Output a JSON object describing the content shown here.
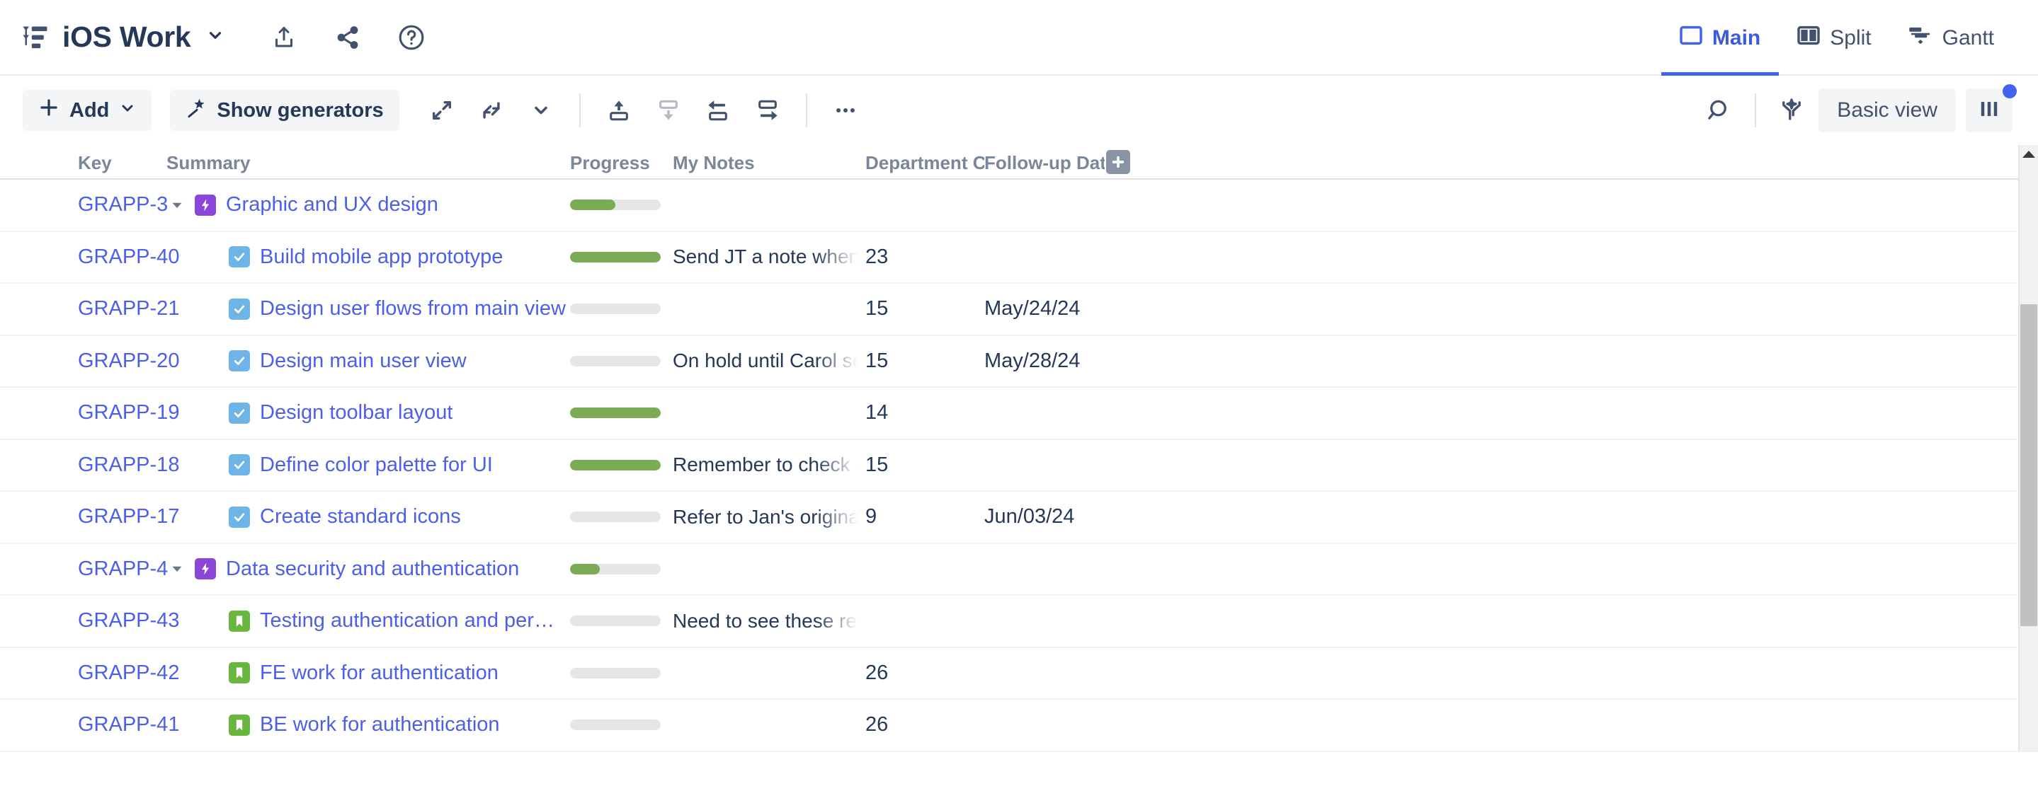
{
  "header": {
    "project_icon": "structure-icon",
    "title": "iOS Work",
    "title_chevron": "chevron-down-icon",
    "actions": [
      {
        "name": "export-icon",
        "label": "Export"
      },
      {
        "name": "share-icon",
        "label": "Share"
      },
      {
        "name": "help-icon",
        "label": "Help"
      }
    ],
    "view_tabs": [
      {
        "label": "Main",
        "icon": "panel-icon",
        "active": true
      },
      {
        "label": "Split",
        "icon": "split-panel-icon",
        "active": false
      },
      {
        "label": "Gantt",
        "icon": "gantt-icon",
        "active": false
      }
    ]
  },
  "toolbar": {
    "add_label": "Add",
    "add_icon": "plus-icon",
    "add_chevron": "chevron-down-icon",
    "generators_label": "Show generators",
    "generators_icon": "magic-wand-icon",
    "expand_all_icon": "expand-arrows-icon",
    "collapse_all_icon": "collapse-arrows-icon",
    "level_chevron_icon": "chevron-down-icon",
    "move_up_icon": "move-up-icon",
    "move_down_icon": "move-down-icon",
    "outdent_icon": "outdent-icon",
    "indent_icon": "indent-icon",
    "more_icon": "more-horizontal-icon",
    "search_icon": "search-icon",
    "filter_icon": "magic-filter-icon",
    "view_label": "Basic view",
    "columns_icon": "columns-icon"
  },
  "table": {
    "columns": [
      "Key",
      "Summary",
      "Progress",
      "My Notes",
      "Department Code",
      "Follow-up Date"
    ],
    "add_column_icon": "plus-icon",
    "rows": [
      {
        "key": "GRAPP-3",
        "summary": "Graphic and UX design",
        "type": "epic",
        "indent": 0,
        "expanded": true,
        "has_children": true,
        "progress": 50,
        "notes": "",
        "dept": "",
        "date": ""
      },
      {
        "key": "GRAPP-40",
        "summary": "Build mobile app prototype",
        "type": "task",
        "indent": 1,
        "expanded": false,
        "has_children": false,
        "progress": 100,
        "notes": "Send JT a note when finished.",
        "dept": "23",
        "date": ""
      },
      {
        "key": "GRAPP-21",
        "summary": "Design user flows from main view",
        "type": "task",
        "indent": 1,
        "expanded": false,
        "has_children": false,
        "progress": 0,
        "notes": "",
        "dept": "15",
        "date": "May/24/24"
      },
      {
        "key": "GRAPP-20",
        "summary": "Design main user view",
        "type": "task",
        "indent": 1,
        "expanded": false,
        "has_children": false,
        "progress": 0,
        "notes": "On hold until Carol sends feedback",
        "dept": "15",
        "date": "May/28/24"
      },
      {
        "key": "GRAPP-19",
        "summary": "Design toolbar layout",
        "type": "task",
        "indent": 1,
        "expanded": false,
        "has_children": false,
        "progress": 100,
        "notes": "",
        "dept": "14",
        "date": ""
      },
      {
        "key": "GRAPP-18",
        "summary": "Define color palette for UI",
        "type": "task",
        "indent": 1,
        "expanded": false,
        "has_children": false,
        "progress": 100,
        "notes": "Remember to check contrast.",
        "dept": "15",
        "date": ""
      },
      {
        "key": "GRAPP-17",
        "summary": "Create standard icons",
        "type": "task",
        "indent": 1,
        "expanded": false,
        "has_children": false,
        "progress": 0,
        "notes": "Refer to Jan's original designs.",
        "dept": "9",
        "date": "Jun/03/24"
      },
      {
        "key": "GRAPP-4",
        "summary": "Data security and authentication",
        "type": "epic",
        "indent": 0,
        "expanded": true,
        "has_children": true,
        "progress": 33,
        "notes": "",
        "dept": "",
        "date": ""
      },
      {
        "key": "GRAPP-43",
        "summary": "Testing authentication and permissions",
        "type": "story",
        "indent": 1,
        "expanded": false,
        "has_children": false,
        "progress": 0,
        "notes": "Need to see these results before finishing",
        "dept": "",
        "date": ""
      },
      {
        "key": "GRAPP-42",
        "summary": "FE work for authentication",
        "type": "story",
        "indent": 1,
        "expanded": false,
        "has_children": false,
        "progress": 0,
        "notes": "",
        "dept": "26",
        "date": ""
      },
      {
        "key": "GRAPP-41",
        "summary": "BE work for authentication",
        "type": "story",
        "indent": 1,
        "expanded": false,
        "has_children": false,
        "progress": 0,
        "notes": "",
        "dept": "26",
        "date": ""
      }
    ]
  },
  "scrollbar": {
    "up_arrow_icon": "caret-up-icon",
    "thumb": "scroll-thumb"
  },
  "colors": {
    "link": "#4c5fe8",
    "accent": "#4263eb",
    "progress_fill": "#7cab55",
    "progress_track": "#e6e6e6",
    "epic": "#8b46d9",
    "task": "#6fb4e8",
    "story": "#69b63f",
    "header_text": "#7a869a"
  }
}
